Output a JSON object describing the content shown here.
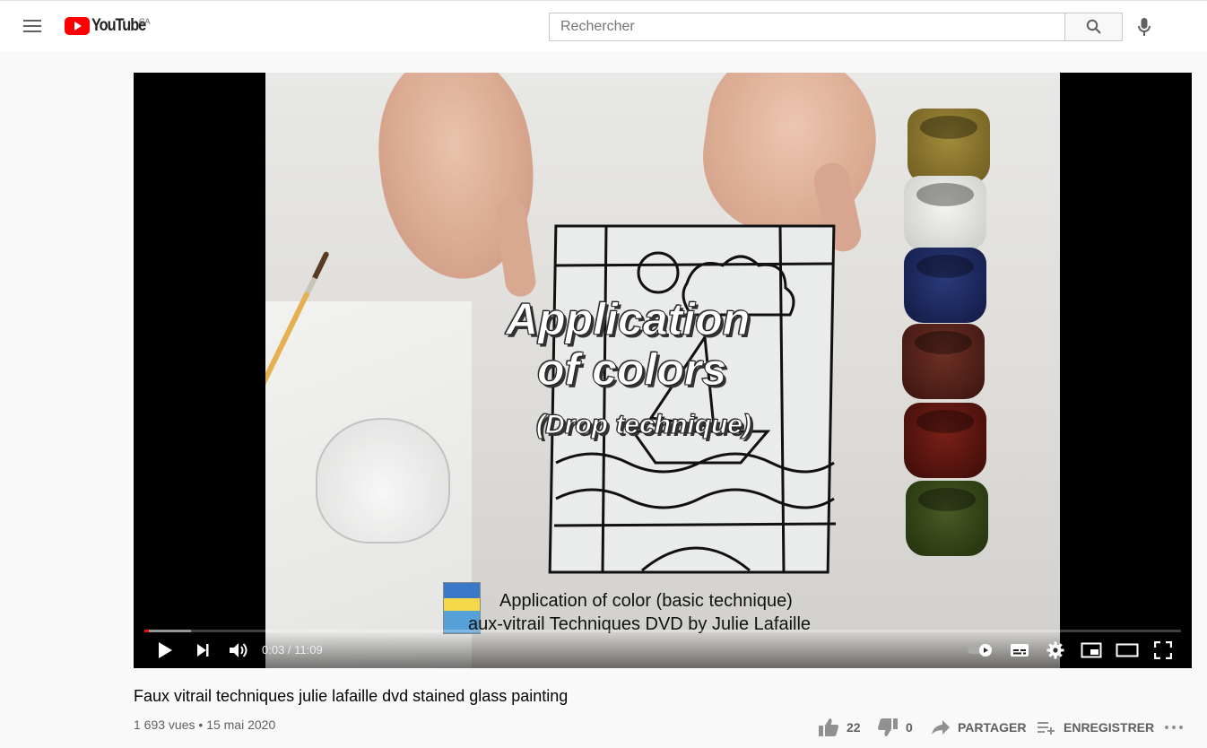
{
  "header": {
    "logo_text": "YouTube",
    "region": "CA",
    "search": {
      "placeholder": "Rechercher",
      "value": ""
    },
    "icons": {
      "menu": "hamburger-menu-icon",
      "search": "search-icon",
      "mic": "microphone-icon"
    }
  },
  "player": {
    "overlay_title_line1": "Application",
    "overlay_title_line2": "of colors",
    "overlay_subtitle": "(Drop technique)",
    "caption_line1": "Application of color (basic technique)",
    "caption_line2": "aux-vitrail Techniques DVD by Julie Lafaille",
    "time_current": "0:03",
    "time_separator": " / ",
    "time_total": "11:09",
    "progress_played_fraction": 0.0045,
    "progress_loaded_fraction": 0.045,
    "autoplay_on": true,
    "colors": {
      "progress": "#ff0000",
      "brand": "#ff0000"
    }
  },
  "video": {
    "title": "Faux vitrail techniques julie lafaille dvd stained glass painting",
    "views": "1 693 vues",
    "separator": " • ",
    "date": "15 mai 2020"
  },
  "actions": {
    "like_count": "22",
    "dislike_count": "0",
    "share_label": "PARTAGER",
    "save_label": "ENREGISTRER"
  }
}
